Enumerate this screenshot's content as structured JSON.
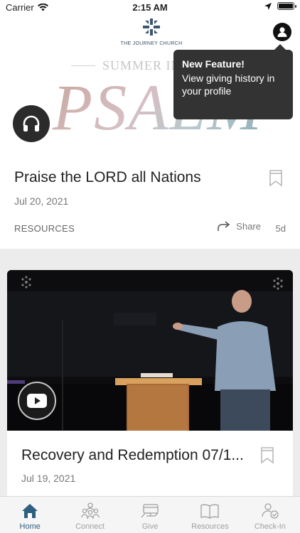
{
  "status_bar": {
    "carrier": "Carrier",
    "time": "2:15 AM"
  },
  "header": {
    "logo_text": "THE JOURNEY CHURCH"
  },
  "hero": {
    "series_small": "SUMMER IN",
    "series_big": "PSALMS"
  },
  "tooltip": {
    "title": "New Feature!",
    "body": "View giving history in your profile"
  },
  "feed": [
    {
      "title": "Praise the LORD all Nations",
      "date": "Jul 20, 2021",
      "category": "RESOURCES",
      "share_label": "Share",
      "age": "5d"
    },
    {
      "title": "Recovery and Redemption 07/1...",
      "date": "Jul 19, 2021"
    }
  ],
  "tabs": [
    {
      "label": "Home",
      "icon": "home-icon",
      "active": true
    },
    {
      "label": "Connect",
      "icon": "people-icon",
      "active": false
    },
    {
      "label": "Give",
      "icon": "give-icon",
      "active": false
    },
    {
      "label": "Resources",
      "icon": "book-icon",
      "active": false
    },
    {
      "label": "Check-In",
      "icon": "checkin-icon",
      "active": false
    }
  ],
  "colors": {
    "accent": "#2f5f80",
    "tooltip_bg": "#333333",
    "card_bg": "#ffffff",
    "page_bg": "#ececec"
  }
}
